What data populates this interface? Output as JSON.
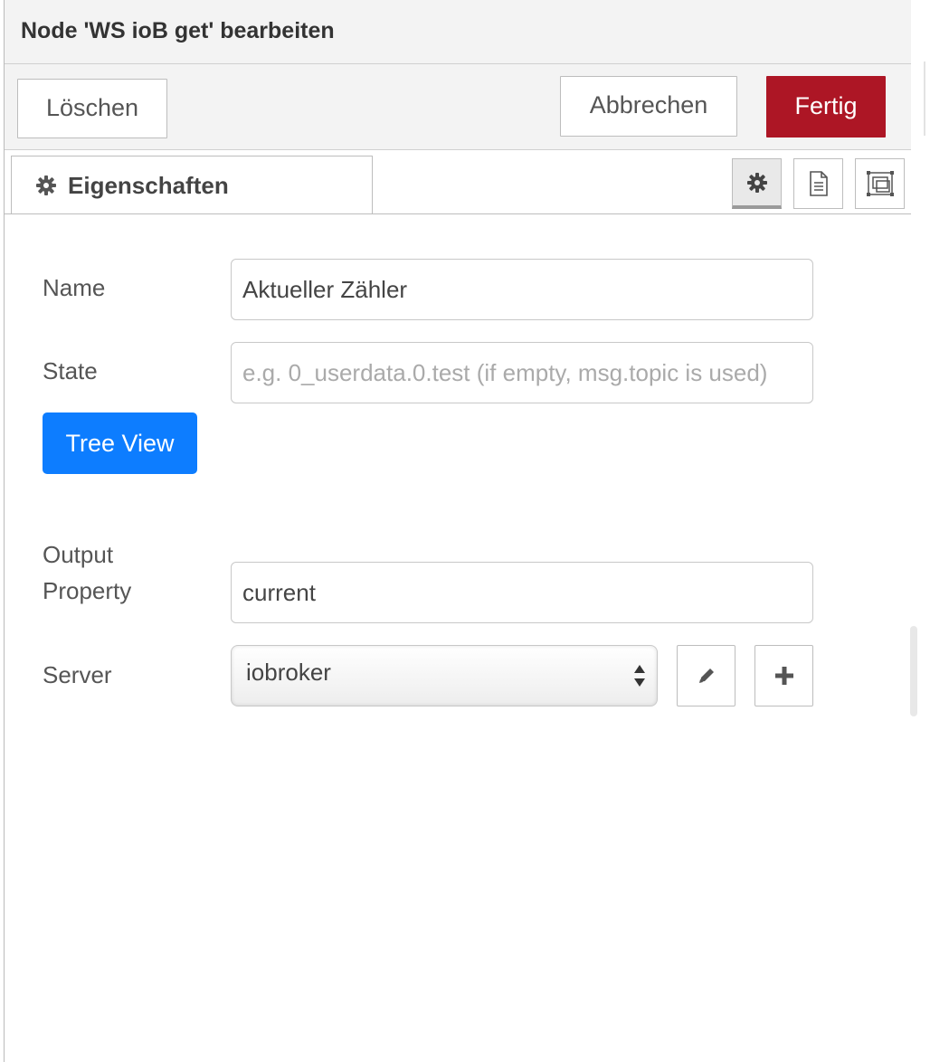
{
  "dialog": {
    "title": "Node 'WS ioB get' bearbeiten"
  },
  "toolbar": {
    "delete_label": "Löschen",
    "cancel_label": "Abbrechen",
    "done_label": "Fertig",
    "done_color": "#ad1625"
  },
  "tabs": {
    "properties_label": "Eigenschaften",
    "icons": [
      "gear-icon",
      "document-icon",
      "appearance-icon"
    ]
  },
  "form": {
    "name": {
      "label": "Name",
      "value": "Aktueller Zähler"
    },
    "state": {
      "label": "State",
      "value": "",
      "placeholder": "e.g. 0_userdata.0.test (if empty, msg.topic is used)"
    },
    "tree_view_label": "Tree View",
    "tree_view_color": "#0d7dff",
    "output_property": {
      "label_line1": "Output",
      "label_line2": "Property",
      "value": "current"
    },
    "server": {
      "label": "Server",
      "selected": "iobroker",
      "edit_icon": "pencil-icon",
      "add_icon": "plus-icon"
    }
  }
}
